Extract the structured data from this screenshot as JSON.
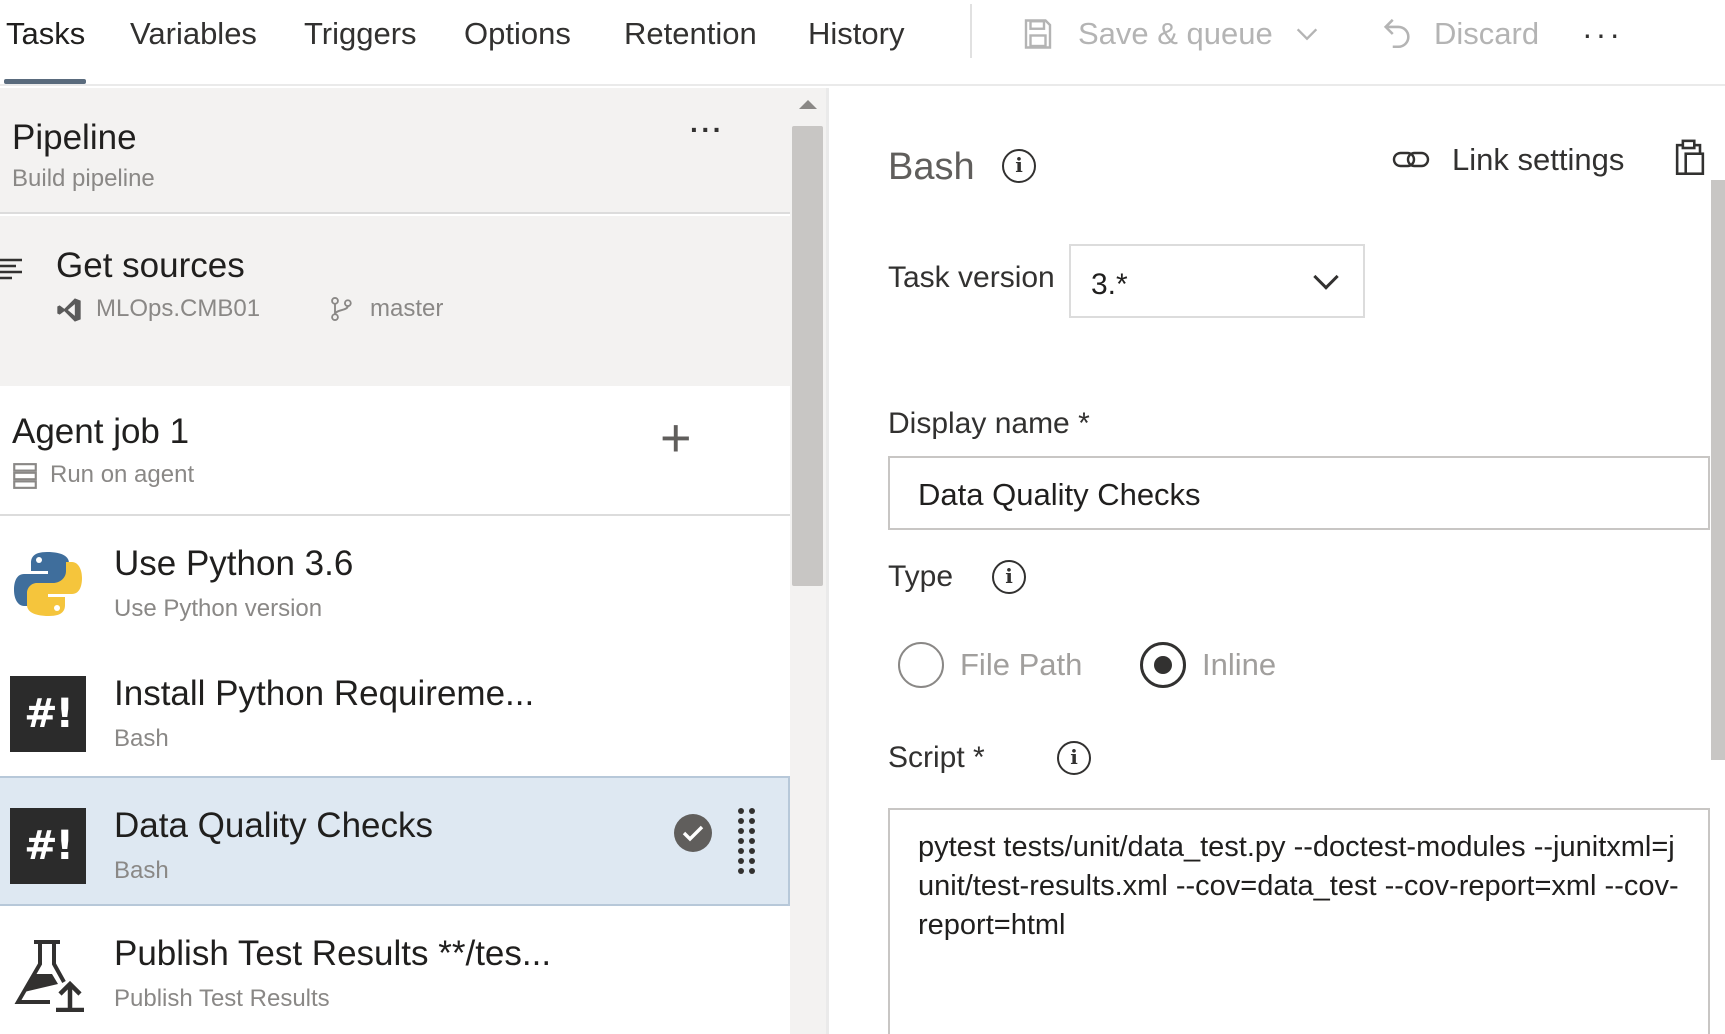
{
  "toolbar": {
    "tabs": [
      {
        "label": "Tasks",
        "active": true
      },
      {
        "label": "Variables"
      },
      {
        "label": "Triggers"
      },
      {
        "label": "Options"
      },
      {
        "label": "Retention"
      },
      {
        "label": "History"
      }
    ],
    "save_queue_label": "Save & queue",
    "discard_label": "Discard",
    "more_label": "···"
  },
  "pipeline": {
    "title": "Pipeline",
    "subtitle": "Build pipeline",
    "more_label": "···"
  },
  "get_sources": {
    "title": "Get sources",
    "repository": "MLOps.CMB01",
    "branch": "master"
  },
  "agent_job": {
    "title": "Agent job 1",
    "subtitle": "Run on agent",
    "add_label": "+"
  },
  "tasks": [
    {
      "title": "Use Python 3.6",
      "subtitle": "Use Python version",
      "icon": "python-icon",
      "selected": false
    },
    {
      "title": "Install Python Requireme...",
      "subtitle": "Bash",
      "icon": "bash-icon",
      "selected": false
    },
    {
      "title": "Data Quality Checks",
      "subtitle": "Bash",
      "icon": "bash-icon",
      "selected": true
    },
    {
      "title": "Publish Test Results **/tes...",
      "subtitle": "Publish Test Results",
      "icon": "publish-test-results-icon",
      "selected": false
    }
  ],
  "bash_icon_text": "#!",
  "details": {
    "heading": "Bash",
    "link_settings_label": "Link settings",
    "task_version_label": "Task version",
    "task_version_value": "3.*",
    "display_name_label": "Display name *",
    "display_name_value": "Data Quality Checks",
    "type_label": "Type",
    "type_options": [
      {
        "label": "File Path",
        "checked": false
      },
      {
        "label": "Inline",
        "checked": true
      }
    ],
    "script_label": "Script *",
    "script_value": "pytest tests/unit/data_test.py --doctest-modules --junitxml=junit/test-results.xml --cov=data_test --cov-report=xml --cov-report=html"
  },
  "colors": {
    "selected_row": "#dee8f2",
    "panel_gray": "#f3f2f1",
    "disabled_text": "#b4b4b4",
    "python_blue": "#3776ab",
    "python_yellow": "#ffd43b"
  }
}
